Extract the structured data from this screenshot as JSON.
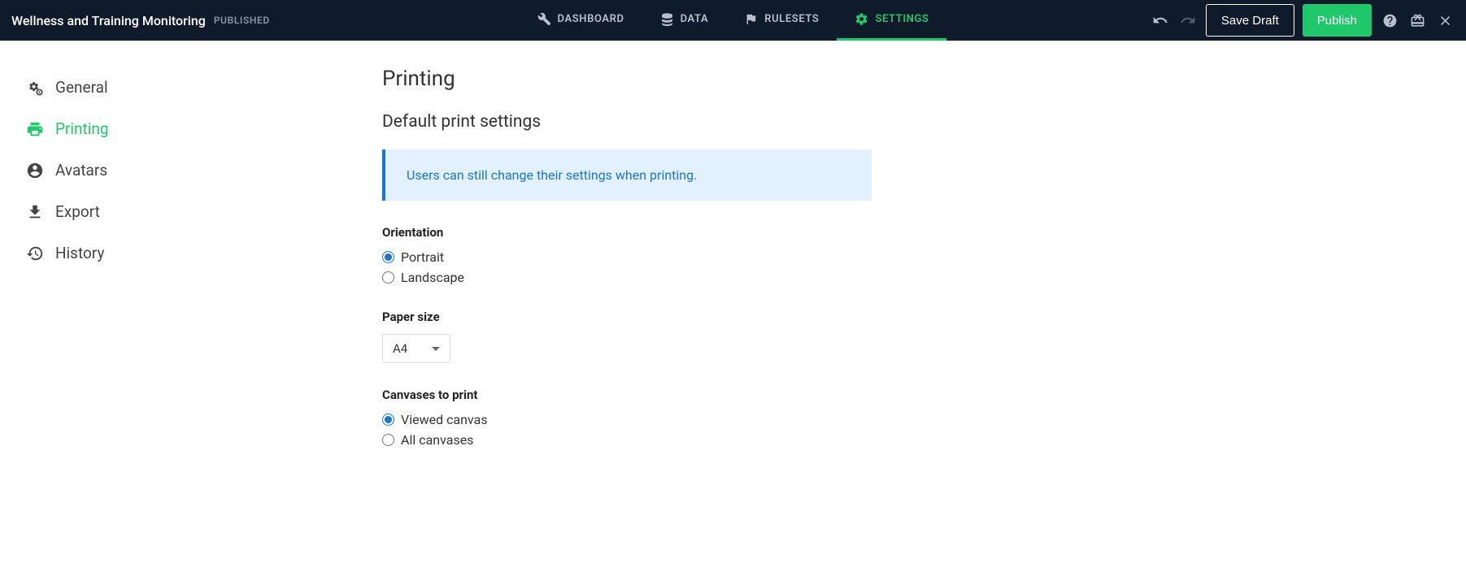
{
  "header": {
    "title": "Wellness and Training Monitoring",
    "status": "PUBLISHED",
    "nav": {
      "dashboard": "DASHBOARD",
      "data": "DATA",
      "rulesets": "RULESETS",
      "settings": "SETTINGS"
    },
    "save_draft": "Save Draft",
    "publish": "Publish"
  },
  "sidebar": {
    "general": "General",
    "printing": "Printing",
    "avatars": "Avatars",
    "export": "Export",
    "history": "History"
  },
  "page": {
    "title": "Printing",
    "section_title": "Default print settings",
    "info": "Users can still change their settings when printing.",
    "orientation": {
      "label": "Orientation",
      "portrait": "Portrait",
      "landscape": "Landscape",
      "selected": "portrait"
    },
    "paper_size": {
      "label": "Paper size",
      "value": "A4"
    },
    "canvases": {
      "label": "Canvases to print",
      "viewed": "Viewed canvas",
      "all": "All canvases",
      "selected": "viewed"
    }
  }
}
